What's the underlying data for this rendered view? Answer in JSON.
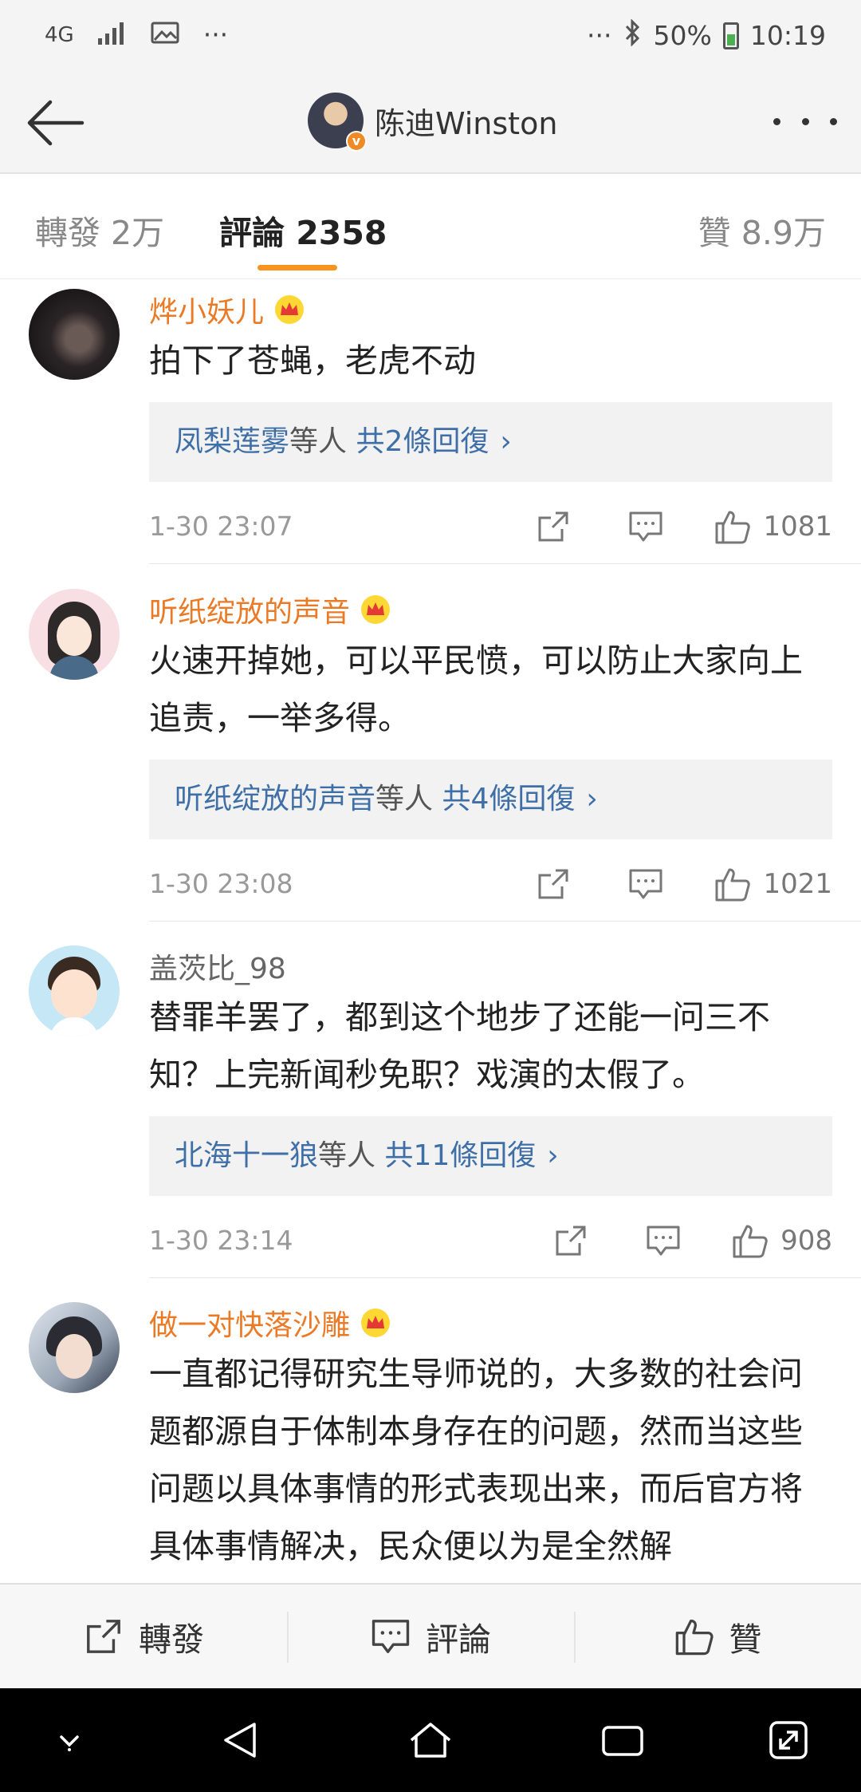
{
  "status_bar": {
    "network": "4G",
    "left_more": "···",
    "right_more": "···",
    "battery": "50%",
    "time": "10:19"
  },
  "nav": {
    "title": "陈迪Winston",
    "verified_badge": "v"
  },
  "tabs": {
    "repost": "轉發 2万",
    "comments": "評論 2358",
    "likes": "贊 8.9万",
    "active": "comments",
    "accent_color": "#f7941d"
  },
  "comments": [
    {
      "username": "烨小妖儿",
      "vip": true,
      "text": "拍下了苍蝇，老虎不动",
      "reply_names": "凤梨莲雾",
      "reply_others": "等人",
      "reply_count": "共2條回復",
      "time": "1-30 23:07",
      "likes": "1081"
    },
    {
      "username": "听纸绽放的声音",
      "vip": true,
      "text": "火速开掉她，可以平民愤，可以防止大家向上追责，一举多得。",
      "reply_names": "听纸绽放的声音",
      "reply_others": "等人",
      "reply_count": "共4條回復",
      "time": "1-30 23:08",
      "likes": "1021"
    },
    {
      "username": "盖茨比_98",
      "vip": false,
      "text": "替罪羊罢了，都到这个地步了还能一问三不知？上完新闻秒免职？戏演的太假了。",
      "reply_names": "北海十一狼",
      "reply_others": "等人",
      "reply_count": "共11條回復",
      "time": "1-30 23:14",
      "likes": "908"
    },
    {
      "username": "做一对快落沙雕",
      "vip": true,
      "text": "一直都记得研究生导师说的，大多数的社会问题都源自于体制本身存在的问题，然而当这些问题以具体事情的形式表现出来，而后官方将具体事情解决，民众便以为是全然解"
    }
  ],
  "action_bar": {
    "repost": "轉發",
    "comment": "評論",
    "like": "贊"
  },
  "colors": {
    "vip_name": "#eb7a27",
    "reply_link": "#3f6fa7"
  }
}
